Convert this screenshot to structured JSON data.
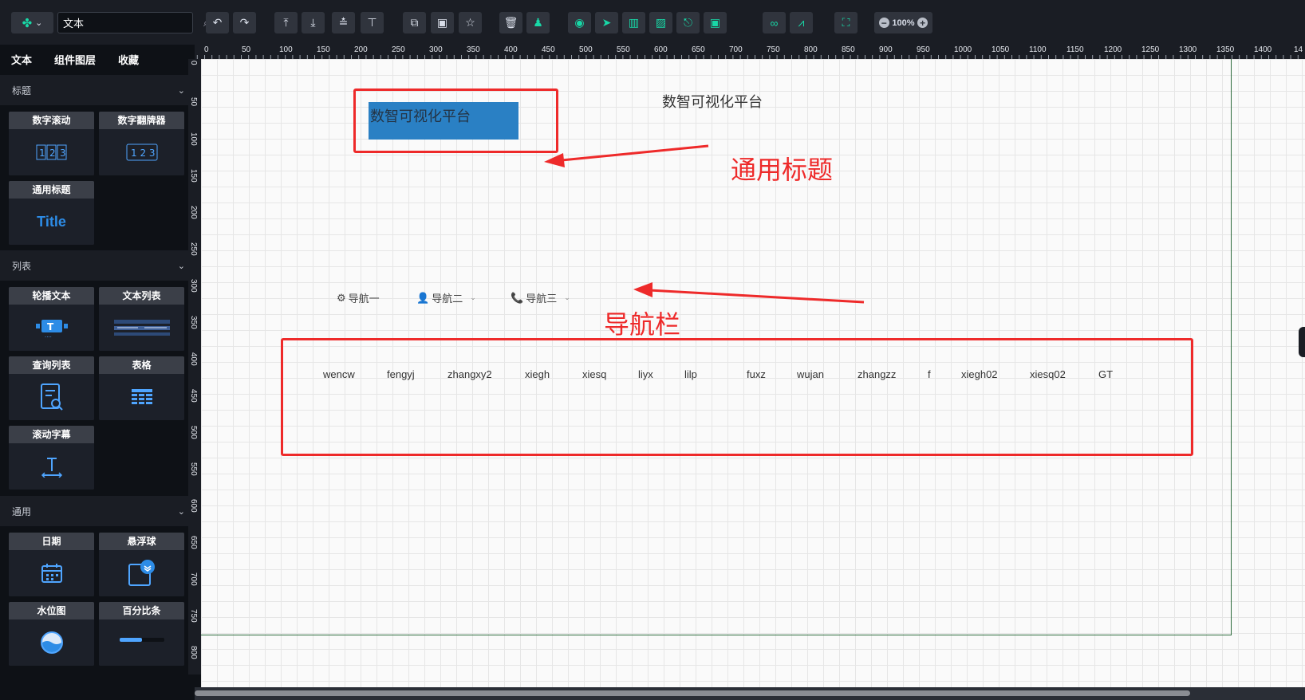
{
  "toolbar": {
    "search": {
      "value": "文本"
    },
    "zoom": {
      "value": "100%",
      "minus": "−",
      "plus": "+"
    }
  },
  "sidebar": {
    "tabs": [
      {
        "label": "文本"
      },
      {
        "label": "组件图层"
      },
      {
        "label": "收藏"
      }
    ],
    "groups": [
      {
        "title": "标题",
        "items": [
          {
            "label": "数字滚动"
          },
          {
            "label": "数字翻牌器"
          },
          {
            "label": "通用标题",
            "thumb_text": "Title"
          }
        ]
      },
      {
        "title": "列表",
        "items": [
          {
            "label": "轮播文本"
          },
          {
            "label": "文本列表"
          },
          {
            "label": "查询列表"
          },
          {
            "label": "表格"
          },
          {
            "label": "滚动字幕"
          }
        ]
      },
      {
        "title": "通用",
        "items": [
          {
            "label": "日期"
          },
          {
            "label": "悬浮球"
          },
          {
            "label": "水位图"
          },
          {
            "label": "百分比条"
          }
        ]
      }
    ]
  },
  "ruler": {
    "top": [
      "0",
      "50",
      "100",
      "150",
      "200",
      "250",
      "300",
      "350",
      "400",
      "450",
      "500",
      "550",
      "600",
      "650",
      "700",
      "750",
      "800",
      "850",
      "900",
      "950",
      "1000",
      "1050",
      "1100",
      "1150",
      "1200",
      "1250",
      "1300",
      "1350",
      "1400",
      "14"
    ],
    "left": [
      "0",
      "50",
      "100",
      "150",
      "200",
      "250",
      "300",
      "350",
      "400",
      "450",
      "500",
      "550",
      "600",
      "650",
      "700",
      "750",
      "800"
    ]
  },
  "canvas": {
    "title_component": "数智可视化平台",
    "title_plain": "数智可视化平台",
    "annotations": {
      "title": "通用标题",
      "nav": "导航栏"
    },
    "nav_items": [
      {
        "label": "导航一"
      },
      {
        "label": "导航二"
      },
      {
        "label": "导航三"
      }
    ],
    "user_list": [
      "wencw",
      "fengyj",
      "zhangxy2",
      "xiegh",
      "xiesq",
      "liyx",
      "lilp",
      "fuxz",
      "wujan",
      "zhangzz",
      "f",
      "xiegh02",
      "xiesq02",
      "GT"
    ]
  },
  "colors": {
    "accent": "#18d8a7",
    "annotation": "#ee2a2a",
    "title_bg": "#2a80c4"
  }
}
